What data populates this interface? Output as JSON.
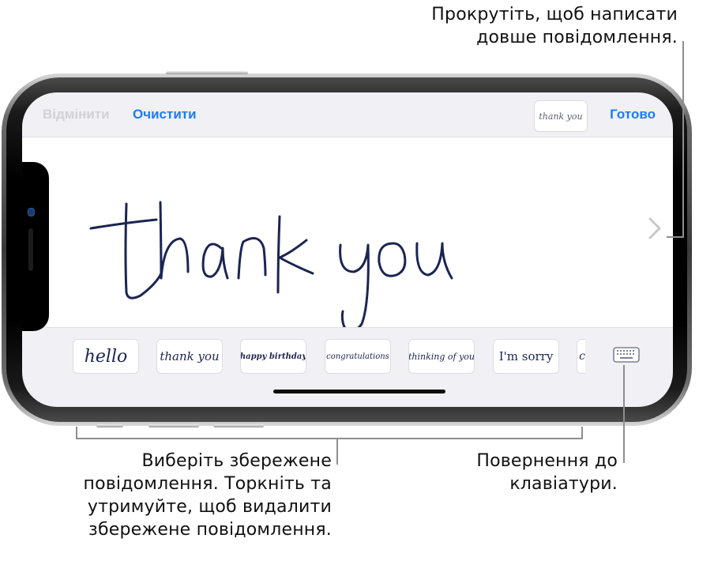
{
  "callouts": {
    "scroll": [
      "Прокрутіть, щоб написати",
      "довше повідомлення."
    ],
    "saved": [
      "Виберіть збережене",
      "повідомлення. Торкніть та",
      "утримуйте, щоб видалити",
      "збережене повідомлення."
    ],
    "keyboard": [
      "Повернення до",
      "клавіатури."
    ]
  },
  "toolbar": {
    "undo_label": "Відмінити",
    "clear_label": "Очистити",
    "preview_text": "thank you",
    "done_label": "Готово"
  },
  "canvas": {
    "handwriting_text": "thank you",
    "scroll_icon": "chevron-right-icon"
  },
  "saved_messages": [
    {
      "text": "hello"
    },
    {
      "text": "thank you"
    },
    {
      "text": "happy birthday"
    },
    {
      "text": "congratulations"
    },
    {
      "text": "thinking of you"
    },
    {
      "text": "I'm sorry"
    },
    {
      "text": "c"
    }
  ],
  "keyboard_button": {
    "icon": "keyboard-icon"
  },
  "colors": {
    "accent": "#1a7cf5",
    "disabled": "#d2d2d6",
    "ink": "#1b2552",
    "screen_bg": "#f0f0f5",
    "leader": "#8e8e8e"
  }
}
